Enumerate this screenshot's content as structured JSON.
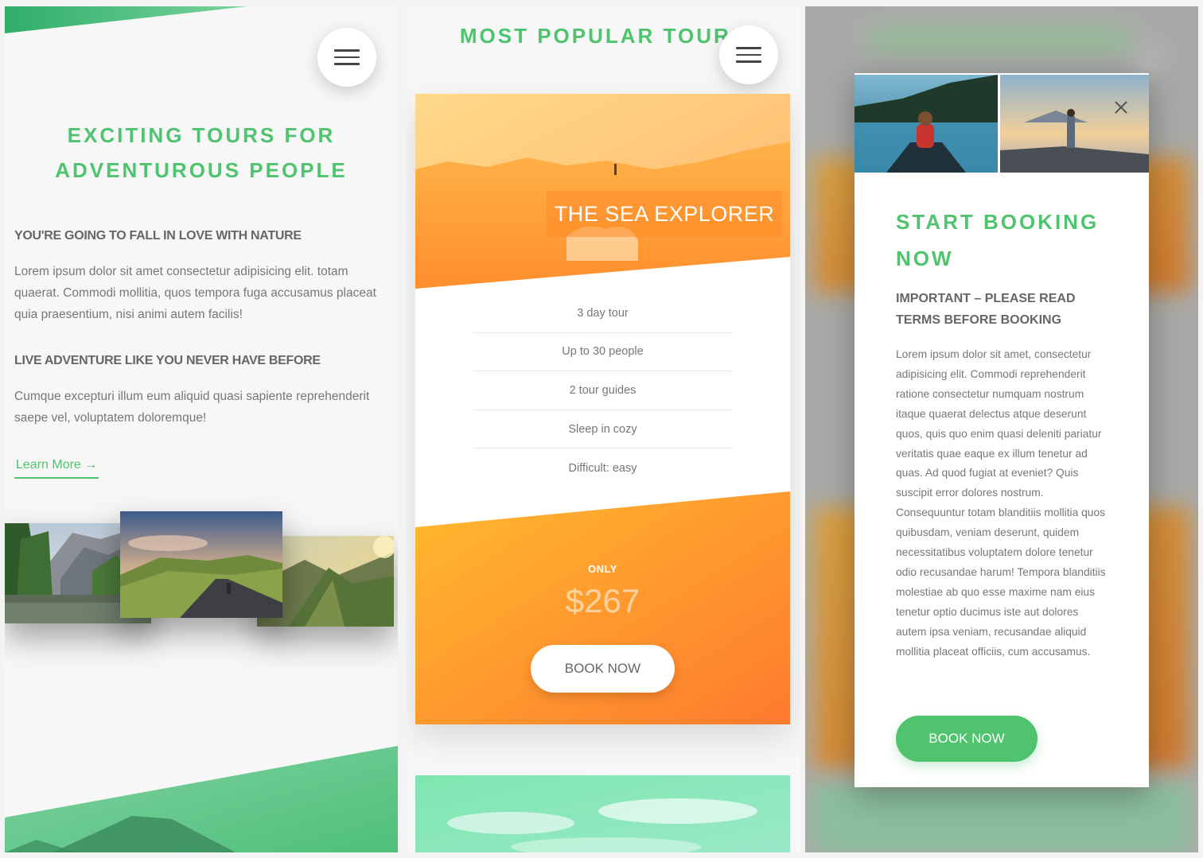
{
  "panel1": {
    "hero_title_line1": "EXCITING TOURS FOR",
    "hero_title_line2": "ADVENTUROUS PEOPLE",
    "heading1": "YOU'RE GOING TO FALL IN LOVE WITH NATURE",
    "paragraph1": "Lorem ipsum dolor sit amet consectetur adipisicing elit. totam quaerat. Commodi mollitia, quos tempora fuga accusamus placeat quia praesentium, nisi animi autem facilis!",
    "heading2": "LIVE ADVENTURE LIKE YOU NEVER HAVE BEFORE",
    "paragraph2": "Cumque excepturi illum eum aliquid quasi sapiente reprehenderit saepe vel, voluptatem doloremque!",
    "learn_more": "Learn More →",
    "menu_icon": "hamburger-menu-icon"
  },
  "panel2": {
    "section_title": "MOST POPULAR TOURS",
    "tour_name": "THE SEA EXPLORER",
    "features": [
      "3 day tour",
      "Up to 30 people",
      "2 tour guides",
      "Sleep in cozy",
      "Difficult: easy"
    ],
    "only_label": "ONLY",
    "price": "$267",
    "book_now": "BOOK NOW",
    "menu_icon": "hamburger-menu-icon"
  },
  "panel3": {
    "modal_title": "START BOOKING NOW",
    "modal_subtitle": "IMPORTANT – PLEASE READ TERMS BEFORE BOOKING",
    "modal_text": "Lorem ipsum dolor sit amet, consectetur adipisicing elit. Commodi reprehenderit ratione consectetur numquam nostrum itaque quaerat delectus atque deserunt quos, quis quo enim quasi deleniti pariatur veritatis quae eaque ex illum tenetur ad quas. Ad quod fugiat at eveniet? Quis suscipit error dolores nostrum. Consequuntur totam blanditiis mollitia quos quibusdam, veniam deserunt, quidem necessitatibus voluptatem dolore tenetur odio recusandae harum! Tempora blanditiis molestiae ab quo esse maxime nam eius tenetur optio ducimus iste aut dolores autem ipsa veniam, recusandae aliquid mollitia placeat officiis, cum accusamus.",
    "book_now": "BOOK NOW",
    "close_icon": "close-icon"
  },
  "colors": {
    "green": "#4fc36d",
    "orange_light": "#ffb636",
    "orange_dark": "#ff7a2e",
    "text": "#777777"
  }
}
